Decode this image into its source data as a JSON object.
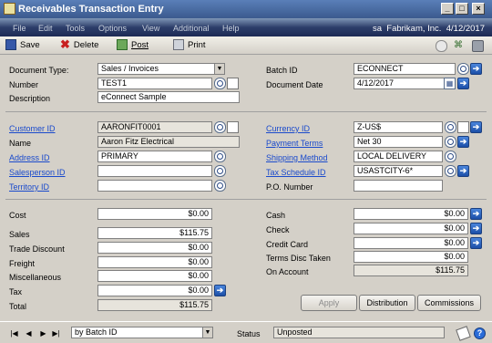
{
  "window": {
    "title": "Receivables Transaction Entry",
    "buttons": [
      "_",
      "□",
      "×"
    ]
  },
  "menu": {
    "items": [
      "File",
      "Edit",
      "Tools",
      "Options",
      "View",
      "Additional",
      "Help"
    ],
    "user": "sa",
    "company": "Fabrikam, Inc.",
    "date": "4/12/2017"
  },
  "toolbar": {
    "save": "Save",
    "delete": "Delete",
    "post": "Post",
    "print": "Print"
  },
  "header": {
    "document_type_label": "Document Type:",
    "document_type_value": "Sales / Invoices",
    "number_label": "Number",
    "number_value": "TEST1",
    "description_label": "Description",
    "description_value": "eConnect Sample",
    "batch_id_label": "Batch ID",
    "batch_id_value": "ECONNECT",
    "document_date_label": "Document Date",
    "document_date_value": "4/12/2017"
  },
  "customer": {
    "customer_id_label": "Customer ID",
    "customer_id_value": "AARONFIT0001",
    "name_label": "Name",
    "name_value": "Aaron Fitz Electrical",
    "address_id_label": "Address ID",
    "address_id_value": "PRIMARY",
    "salesperson_id_label": "Salesperson ID",
    "salesperson_id_value": "",
    "territory_id_label": "Territory ID",
    "territory_id_value": "",
    "currency_id_label": "Currency ID",
    "currency_id_value": "Z-US$",
    "payment_terms_label": "Payment Terms",
    "payment_terms_value": "Net 30",
    "shipping_method_label": "Shipping Method",
    "shipping_method_value": "LOCAL DELIVERY",
    "tax_schedule_id_label": "Tax Schedule ID",
    "tax_schedule_id_value": "USASTCITY-6*",
    "po_number_label": "P.O. Number",
    "po_number_value": ""
  },
  "amounts": {
    "cost_label": "Cost",
    "cost_value": "$0.00",
    "sales_label": "Sales",
    "sales_value": "$115.75",
    "trade_discount_label": "Trade Discount",
    "trade_discount_value": "$0.00",
    "freight_label": "Freight",
    "freight_value": "$0.00",
    "miscellaneous_label": "Miscellaneous",
    "miscellaneous_value": "$0.00",
    "tax_label": "Tax",
    "tax_value": "$0.00",
    "total_label": "Total",
    "total_value": "$115.75",
    "cash_label": "Cash",
    "cash_value": "$0.00",
    "check_label": "Check",
    "check_value": "$0.00",
    "credit_card_label": "Credit Card",
    "credit_card_value": "$0.00",
    "terms_disc_taken_label": "Terms Disc Taken",
    "terms_disc_taken_value": "$0.00",
    "on_account_label": "On Account",
    "on_account_value": "$115.75"
  },
  "actions": {
    "apply": "Apply",
    "distribution": "Distribution",
    "commissions": "Commissions"
  },
  "footer": {
    "sort_value": "by Batch ID",
    "status_label": "Status",
    "status_value": "Unposted"
  },
  "colors": {
    "menu_bg": "#1d2a55",
    "link": "#1a4acc",
    "face": "#d4d0c8"
  }
}
